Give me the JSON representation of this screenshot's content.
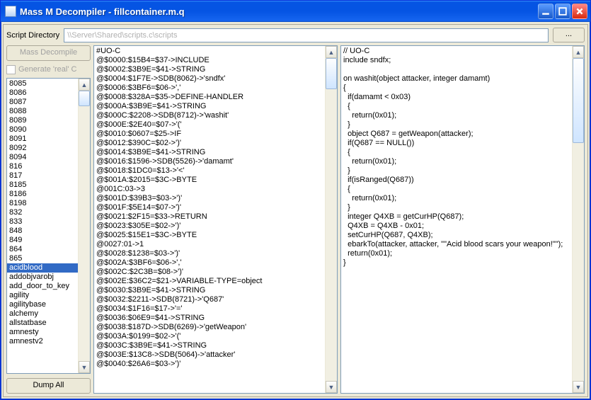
{
  "window": {
    "title": "Mass M Decompiler - fillcontainer.m.q"
  },
  "toolbar": {
    "script_dir_label": "Script Directory",
    "path_placeholder": "\\\\Server\\Shared\\scripts.c\\scripts",
    "browse_label": "..."
  },
  "left": {
    "mass_decompile_label": "Mass Decompile",
    "generate_real_c_label": "Generate 'real' C",
    "dump_all_label": "Dump All",
    "items": [
      "8085",
      "8086",
      "8087",
      "8088",
      "8089",
      "8090",
      "8091",
      "8092",
      "8094",
      "816",
      "817",
      "8185",
      "8186",
      "8198",
      "832",
      "833",
      "848",
      "849",
      "864",
      "865",
      "acidblood",
      "addobjvarobj",
      "add_door_to_key",
      "agility",
      "agilitybase",
      "alchemy",
      "allstatbase",
      "amnesty",
      "amnestv2"
    ],
    "selected_index": 20
  },
  "middle_code": "#UO-C\n@$0000:$15B4=$37->INCLUDE\n@$0002:$3B9E=$41->STRING\n@$0004:$1F7E->SDB(8062)->'sndfx'\n@$0006:$3BF6=$06->','\n@$0008:$328A=$35->DEFINE-HANDLER\n@$000A:$3B9E=$41->STRING\n@$000C:$2208->SDB(8712)->'washit'\n@$000E:$2E40=$07->'('\n@$0010:$0607=$25->IF\n@$0012:$390C=$02->')'\n@$0014:$3B9E=$41->STRING\n@$0016:$1596->SDB(5526)->'damamt'\n@$0018:$1DC0=$13->'<'\n@$001A:$2015=$3C->BYTE\n@001C:03->3\n@$001D:$39B3=$03->')'\n@$001F:$5E14=$07->')'\n@$0021:$2F15=$33->RETURN\n@$0023:$305E=$02->')'\n@$0025:$15E1=$3C->BYTE\n@0027:01->1\n@$0028:$1238=$03->')'\n@$002A:$3BF6=$06->','\n@$002C:$2C3B=$08->')'\n@$002E:$36C2=$21->VARIABLE-TYPE=object\n@$0030:$3B9E=$41->STRING\n@$0032:$2211->SDB(8721)->'Q687'\n@$0034:$1F16=$17->'='\n@$0036:$06E9=$41->STRING\n@$0038:$187D->SDB(6269)->'getWeapon'\n@$003A:$0199=$02->'('\n@$003C:$3B9E=$41->STRING\n@$003E:$13C8->SDB(5064)->'attacker'\n@$0040:$26A6=$03->')'",
  "right_code": "// UO-C\ninclude sndfx;\n\non washit(object attacker, integer damamt)\n{\n  if(damamt < 0x03)\n  {\n    return(0x01);\n  }\n  object Q687 = getWeapon(attacker);\n  if(Q687 == NULL())\n  {\n    return(0x01);\n  }\n  if(isRanged(Q687))\n  {\n    return(0x01);\n  }\n  integer Q4XB = getCurHP(Q687);\n  Q4XB = Q4XB - 0x01;\n  setCurHP(Q687, Q4XB);\n  ebarkTo(attacker, attacker, \"\"Acid blood scars your weapon!\"\");\n  return(0x01);\n}",
  "colors": {
    "selection": "#316ac5",
    "title_gradient_top": "#3a93ff",
    "title_gradient_bottom": "#0554e3"
  }
}
